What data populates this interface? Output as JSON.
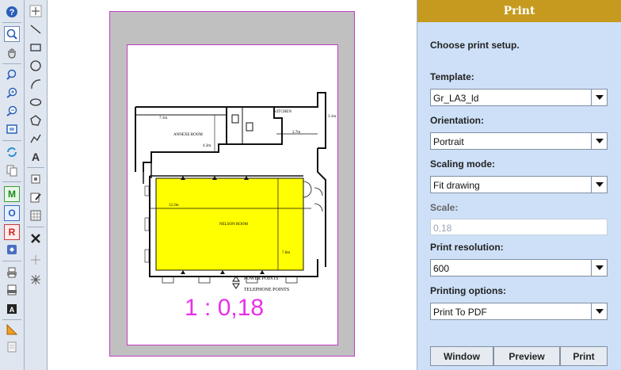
{
  "canvas": {
    "scale_label": "1 : 0,18"
  },
  "panel": {
    "title": "Print",
    "intro": "Choose print setup.",
    "template": {
      "label": "Template:",
      "value": "Gr_LA3_ld"
    },
    "orientation": {
      "label": "Orientation:",
      "value": "Portrait"
    },
    "scaling_mode": {
      "label": "Scaling mode:",
      "value": "Fit drawing"
    },
    "scale": {
      "label": "Scale:",
      "value": "0,18"
    },
    "resolution": {
      "label": "Print resolution:",
      "value": "600"
    },
    "options": {
      "label": "Printing options:",
      "value": "Print To PDF"
    },
    "buttons": {
      "window": "Window",
      "preview": "Preview",
      "print": "Print"
    }
  },
  "floorplan": {
    "annexe_room": "ANNEXE ROOM",
    "kitchen": "KITCHEN",
    "nelson_room": "NELSON ROOM",
    "legend_power": "POWER POINTS",
    "legend_telephone": "TELEPHONE POINTS",
    "dim_top": "7.1m",
    "dim_annexe": "4.3m",
    "dim_kitchen_w": "2.7m",
    "dim_kitchen_h": "3.1m",
    "dim_nelson_w": "12.2m",
    "dim_nelson_h": "7.6m"
  },
  "colors": {
    "room_fill": "#ffff00",
    "page_border": "#c13cc1",
    "scale_text": "#e830e8",
    "panel_header": "#c59a1f"
  }
}
